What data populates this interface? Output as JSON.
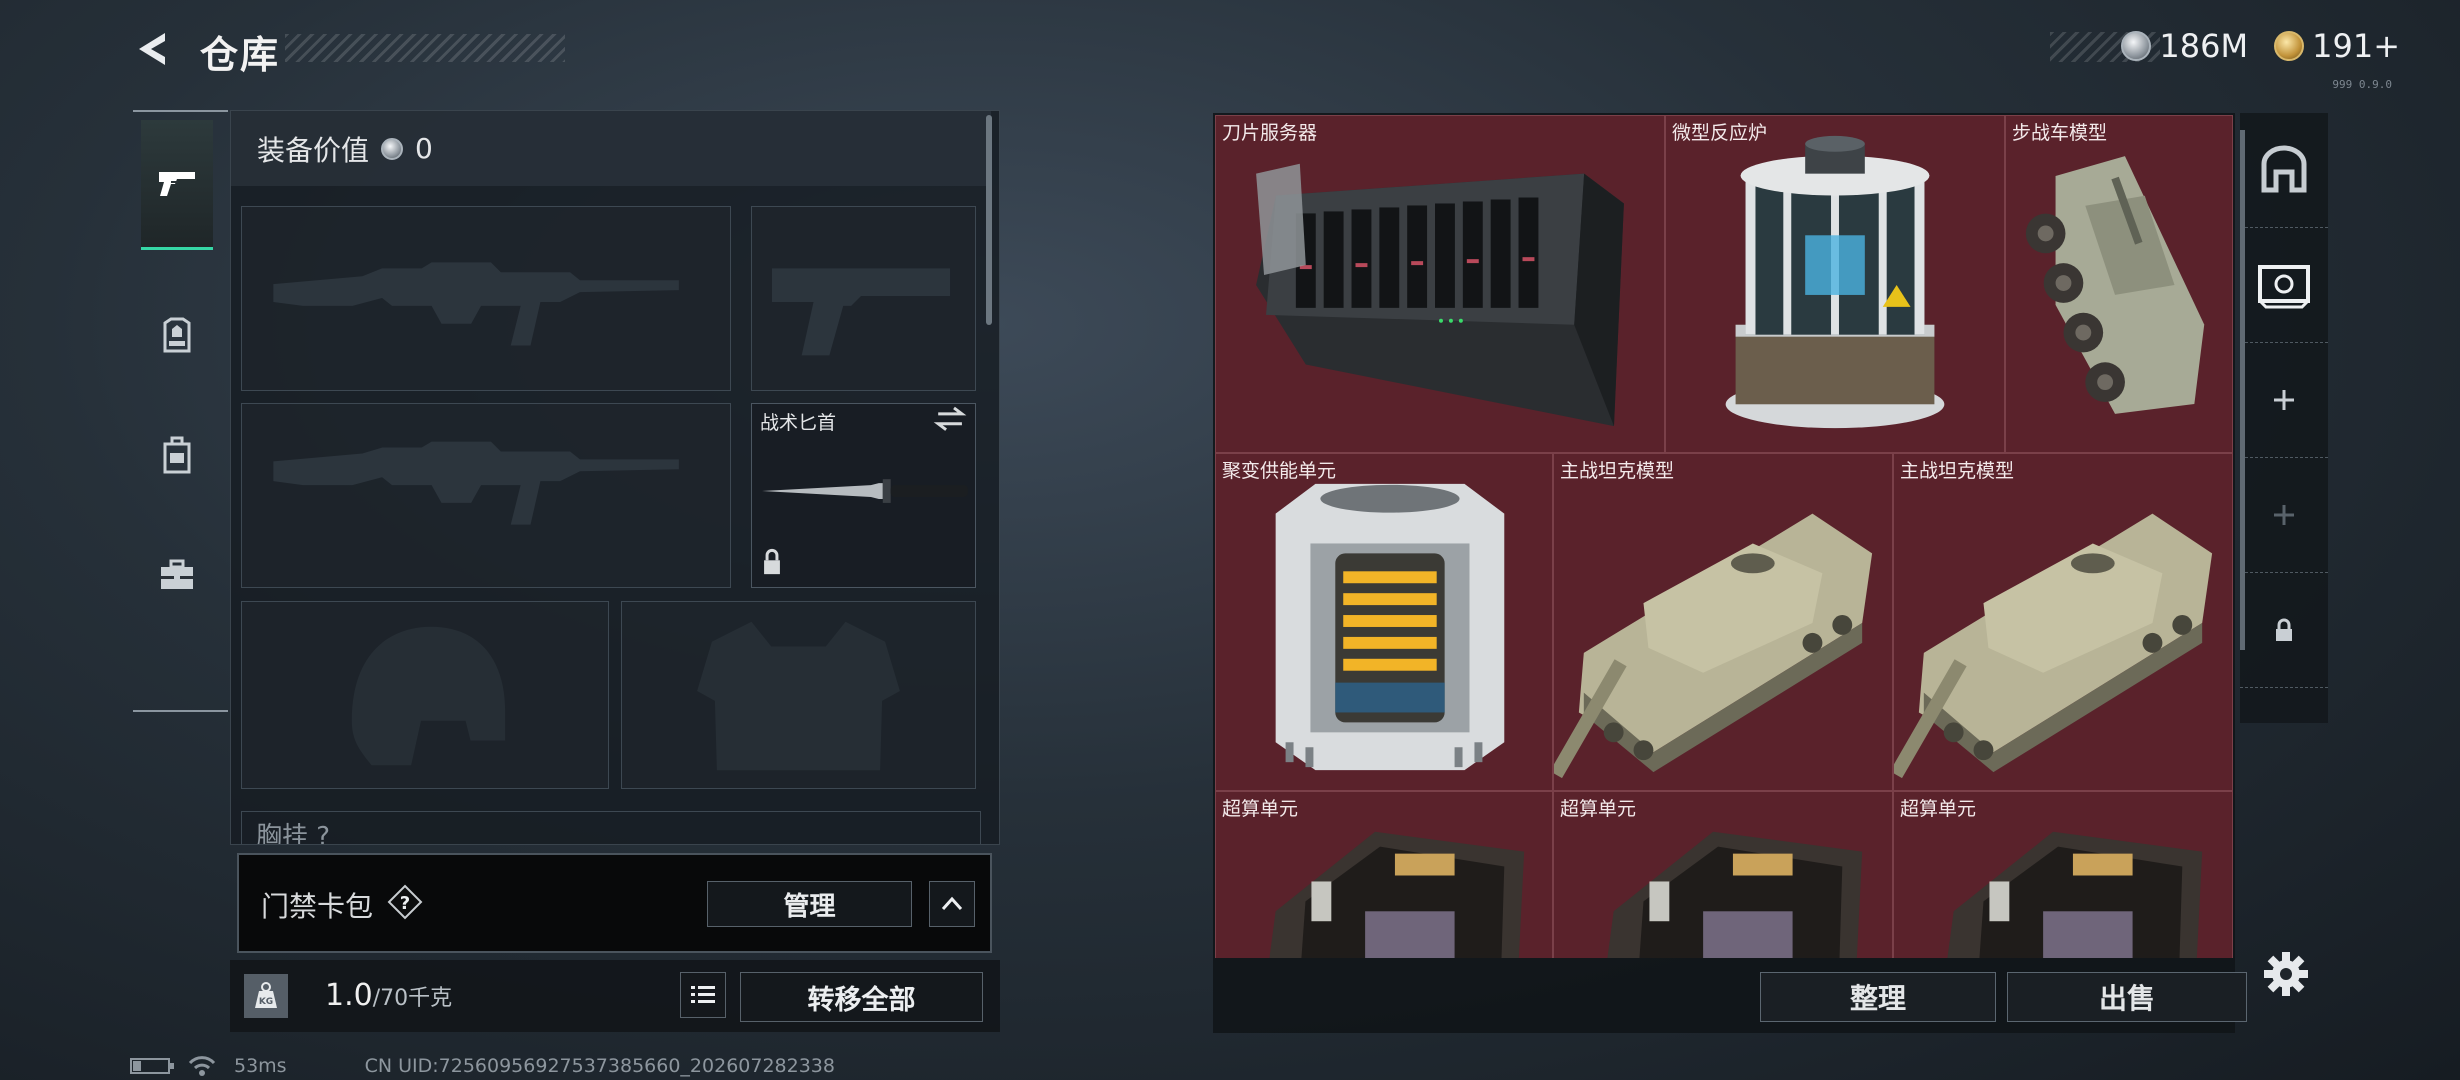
{
  "header": {
    "title": "仓库",
    "currencies": [
      {
        "type": "silver",
        "value": "186M"
      },
      {
        "type": "gold",
        "value": "191+"
      }
    ],
    "version": "999 0.9.0"
  },
  "side_tabs": [
    {
      "name": "weapon",
      "icon": "pistol-icon",
      "active": true
    },
    {
      "name": "gear",
      "icon": "armor-icon"
    },
    {
      "name": "backpack",
      "icon": "backpack-icon"
    },
    {
      "name": "case",
      "icon": "toolbox-icon"
    }
  ],
  "loadout": {
    "equip_value_label": "装备价值",
    "equip_value": "0",
    "slots": [
      {
        "name": "primary-weapon-slot-1",
        "icon": "rifle-silhouette"
      },
      {
        "name": "pistol-slot",
        "icon": "pistol-silhouette"
      },
      {
        "name": "primary-weapon-slot-2",
        "icon": "rifle-silhouette"
      },
      {
        "name": "melee-slot",
        "label": "战术匕首",
        "icon": "knife"
      },
      {
        "name": "helmet-slot",
        "icon": "helmet-silhouette"
      },
      {
        "name": "armor-slot",
        "icon": "vest-silhouette"
      }
    ],
    "chest_label": "胸挂 ?"
  },
  "keycard": {
    "label": "门禁卡包",
    "help": "?",
    "manage": "管理"
  },
  "weight": {
    "current": "1.0",
    "max": "/70千克",
    "transfer_all": "转移全部"
  },
  "stash": {
    "items": [
      {
        "name": "刀片服务器",
        "icon": "blade-server-icon"
      },
      {
        "name": "微型反应炉",
        "icon": "micro-reactor-icon"
      },
      {
        "name": "步战车模型",
        "icon": "ifv-model-icon"
      },
      {
        "name": "聚变供能单元",
        "icon": "fusion-unit-icon"
      },
      {
        "name": "主战坦克模型",
        "icon": "tank-model-icon"
      },
      {
        "name": "主战坦克模型",
        "icon": "tank-model-icon"
      },
      {
        "name": "超算单元",
        "icon": "supercomputer-unit-icon"
      },
      {
        "name": "超算单元",
        "icon": "supercomputer-unit-icon"
      },
      {
        "name": "超算单元",
        "icon": "supercomputer-unit-icon"
      }
    ],
    "sort": "整理",
    "sell": "出售"
  },
  "right_tabs": [
    {
      "icon": "stash-icon"
    },
    {
      "icon": "safe-box-icon"
    },
    {
      "icon": "plus-icon"
    },
    {
      "icon": "plus-icon-dim"
    },
    {
      "icon": "lock-icon"
    }
  ],
  "status": {
    "ping": "53ms",
    "uid": "CN UID:72560956927537385660_202607282338"
  }
}
